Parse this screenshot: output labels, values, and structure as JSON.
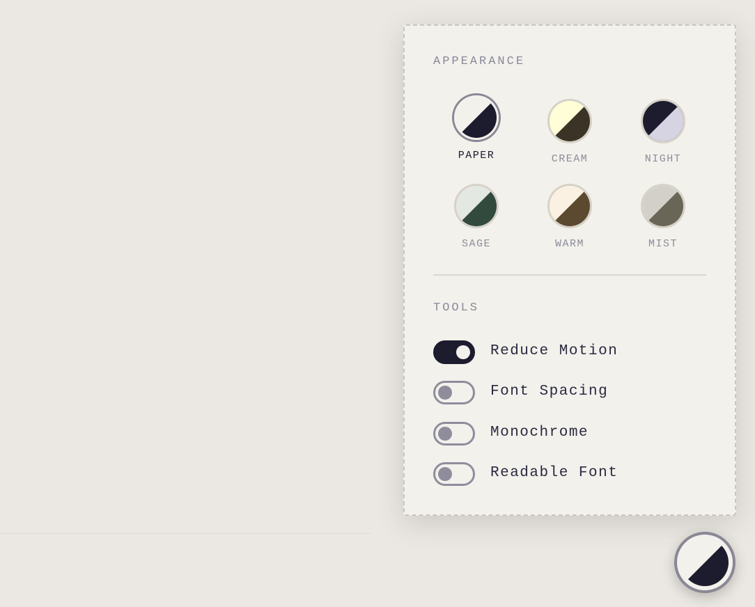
{
  "appearance": {
    "label": "APPEARANCE",
    "selected": "PAPER",
    "themes": [
      {
        "name": "PAPER",
        "light": "#f3f1ec",
        "dark": "#1c1c2e"
      },
      {
        "name": "CREAM",
        "light": "#fffed6",
        "dark": "#3b3426"
      },
      {
        "name": "NIGHT",
        "light": "#1c1c2e",
        "dark": "#d6d4e2"
      },
      {
        "name": "SAGE",
        "light": "#e4e8e2",
        "dark": "#324a3e"
      },
      {
        "name": "WARM",
        "light": "#faf1e2",
        "dark": "#5b4a30"
      },
      {
        "name": "MIST",
        "light": "#d2d0c8",
        "dark": "#696658"
      }
    ]
  },
  "tools": {
    "label": "TOOLS",
    "items": [
      {
        "label": "Reduce Motion",
        "on": true
      },
      {
        "label": "Font Spacing",
        "on": false
      },
      {
        "label": "Monochrome",
        "on": false
      },
      {
        "label": "Readable Font",
        "on": false
      }
    ]
  },
  "fab": {
    "icon": "theme-half-circle-icon",
    "light": "#f3f1ec",
    "dark": "#1c1c2e"
  }
}
